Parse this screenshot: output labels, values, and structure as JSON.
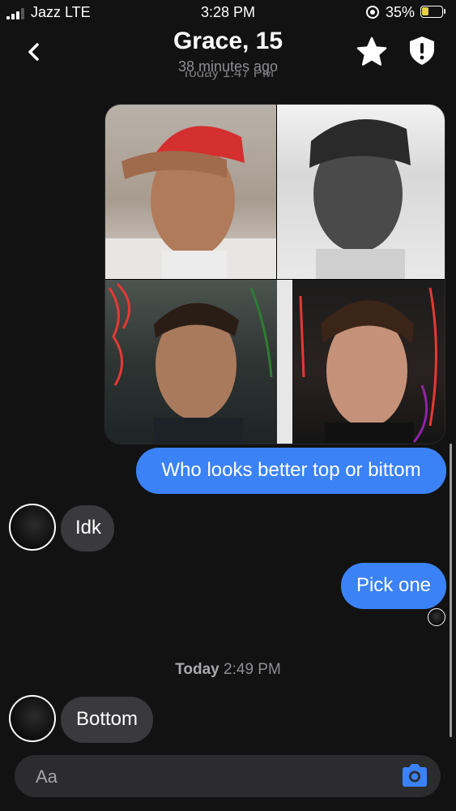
{
  "status_bar": {
    "carrier": "Jazz LTE",
    "time": "3:28 PM",
    "battery": "35%",
    "battery_level": 0.35
  },
  "header": {
    "title": "Grace, 15",
    "subtitle": "38 minutes ago",
    "partial_date": "Today 1:47 PM"
  },
  "messages": [
    {
      "direction": "outgoing",
      "text": "Who looks better top or bittom"
    },
    {
      "direction": "incoming",
      "text": "Idk"
    },
    {
      "direction": "outgoing",
      "text": "Pick one"
    },
    {
      "direction": "incoming",
      "text": "Bottom"
    }
  ],
  "date_separator": {
    "day": "Today",
    "time": "2:49 PM"
  },
  "composer": {
    "placeholder": "Aa"
  },
  "colors": {
    "background": "#121212",
    "outgoing_bubble": "#3b82f6",
    "incoming_bubble": "#3a3a3c",
    "camera_accent": "#3b82f6"
  }
}
